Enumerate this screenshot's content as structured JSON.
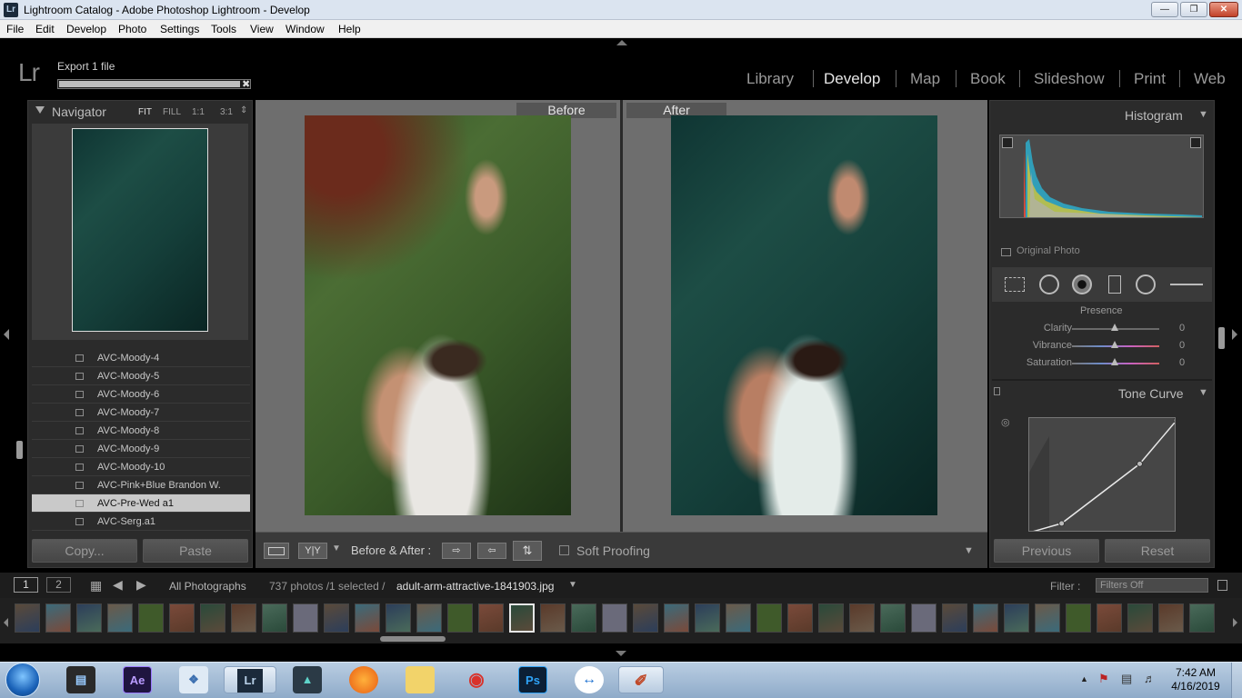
{
  "window": {
    "app_icon": "Lr",
    "title": "Lightroom Catalog - Adobe Photoshop Lightroom - Develop"
  },
  "menu": [
    "File",
    "Edit",
    "Develop",
    "Photo",
    "Settings",
    "Tools",
    "View",
    "Window",
    "Help"
  ],
  "identity": {
    "logo": "Lr",
    "task_label": "Export 1 file",
    "task_progress": 0.95
  },
  "modules": [
    {
      "label": "Library",
      "active": false
    },
    {
      "label": "Develop",
      "active": true
    },
    {
      "label": "Map",
      "active": false
    },
    {
      "label": "Book",
      "active": false
    },
    {
      "label": "Slideshow",
      "active": false
    },
    {
      "label": "Print",
      "active": false
    },
    {
      "label": "Web",
      "active": false
    }
  ],
  "navigator": {
    "title": "Navigator",
    "zoom_options": [
      "FIT",
      "FILL",
      "1:1",
      "3:1"
    ],
    "selected_zoom": "FIT"
  },
  "presets": [
    {
      "label": "AVC-Moody-4",
      "selected": false
    },
    {
      "label": "AVC-Moody-5",
      "selected": false
    },
    {
      "label": "AVC-Moody-6",
      "selected": false
    },
    {
      "label": "AVC-Moody-7",
      "selected": false
    },
    {
      "label": "AVC-Moody-8",
      "selected": false
    },
    {
      "label": "AVC-Moody-9",
      "selected": false
    },
    {
      "label": "AVC-Moody-10",
      "selected": false
    },
    {
      "label": "AVC-Pink+Blue Brandon W.",
      "selected": false
    },
    {
      "label": "AVC-Pre-Wed a1",
      "selected": true
    },
    {
      "label": "AVC-Serg.a1",
      "selected": false
    }
  ],
  "left_buttons": {
    "copy": "Copy...",
    "paste": "Paste"
  },
  "compare": {
    "before_label": "Before",
    "after_label": "After"
  },
  "toolbar": {
    "before_after_label": "Before & After :",
    "yy_label": "Y|Y",
    "soft_proofing_label": "Soft Proofing"
  },
  "histogram": {
    "title": "Histogram",
    "original_photo_label": "Original Photo"
  },
  "presence": {
    "title": "Presence",
    "sliders": [
      {
        "label": "Clarity",
        "value": "0"
      },
      {
        "label": "Vibrance",
        "value": "0"
      },
      {
        "label": "Saturation",
        "value": "0"
      }
    ]
  },
  "tone_curve": {
    "title": "Tone Curve",
    "points": [
      [
        0,
        0
      ],
      [
        0.22,
        0.08
      ],
      [
        0.75,
        0.6
      ],
      [
        1,
        0.98
      ]
    ]
  },
  "right_buttons": {
    "previous": "Previous",
    "reset": "Reset"
  },
  "filmstrip": {
    "view1": "1",
    "view2": "2",
    "source": "All Photographs",
    "count_text": "737 photos /1 selected /",
    "filename": "adult-arm-attractive-1841903.jpg",
    "filter_label": "Filter :",
    "filter_value": "Filters Off"
  },
  "taskbar": {
    "apps": [
      "windows-media-player",
      "after-effects",
      "app-launcher",
      "lightroom",
      "filmora",
      "firefox",
      "file-explorer",
      "screen-recorder",
      "photoshop",
      "teamviewer",
      "paint"
    ],
    "time": "7:42 AM",
    "date": "4/16/2019"
  }
}
